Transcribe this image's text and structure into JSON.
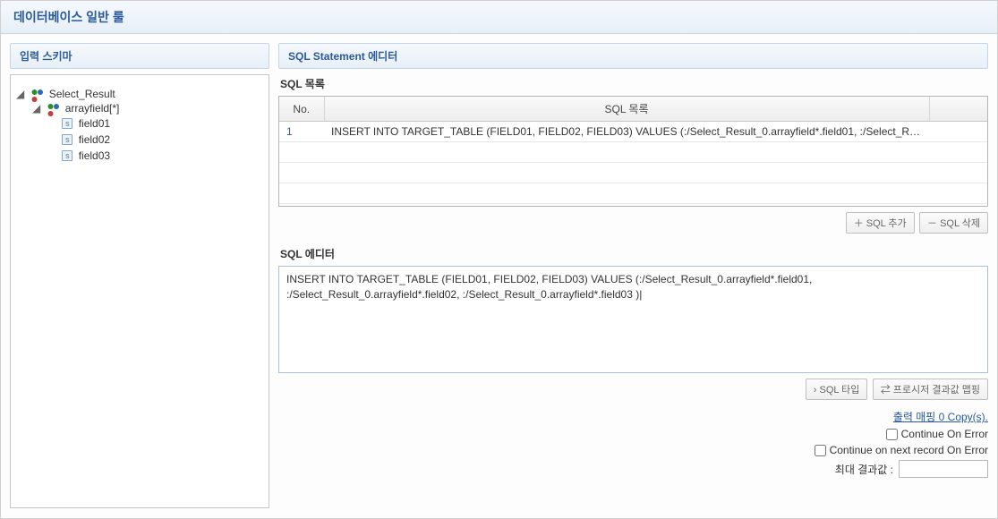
{
  "title": "데이터베이스 일반 룰",
  "left": {
    "header": "입력 스키마",
    "tree": {
      "root": "Select_Result",
      "array": "arrayfield[*]",
      "f1": "field01",
      "f2": "field02",
      "f3": "field03"
    }
  },
  "right": {
    "header": "SQL Statement 에디터",
    "list_label": "SQL 목록",
    "col_no": "No.",
    "col_sql": "SQL 목록",
    "rows": [
      {
        "no": "1",
        "sql": "INSERT INTO TARGET_TABLE (FIELD01, FIELD02, FIELD03) VALUES (:/Select_Result_0.arrayfield*.field01, :/Select_Res..."
      }
    ],
    "btn_add": "＋ SQL 추가",
    "btn_del": "－ SQL 삭제",
    "editor_label": "SQL 에디터",
    "editor_value": "INSERT INTO TARGET_TABLE (FIELD01, FIELD02, FIELD03) VALUES (:/Select_Result_0.arrayfield*.field01, :/Select_Result_0.arrayfield*.field02, :/Select_Result_0.arrayfield*.field03 )|",
    "btn_type": "› SQL 타입",
    "btn_proc": "⇄ 프로시저 결과값 맵핑",
    "out_link": "출력 매핑 0 Copy(s).",
    "chk1": "Continue On Error",
    "chk2": "Continue on next record On Error",
    "max_label": "최대 결과값 :",
    "max_value": ""
  }
}
